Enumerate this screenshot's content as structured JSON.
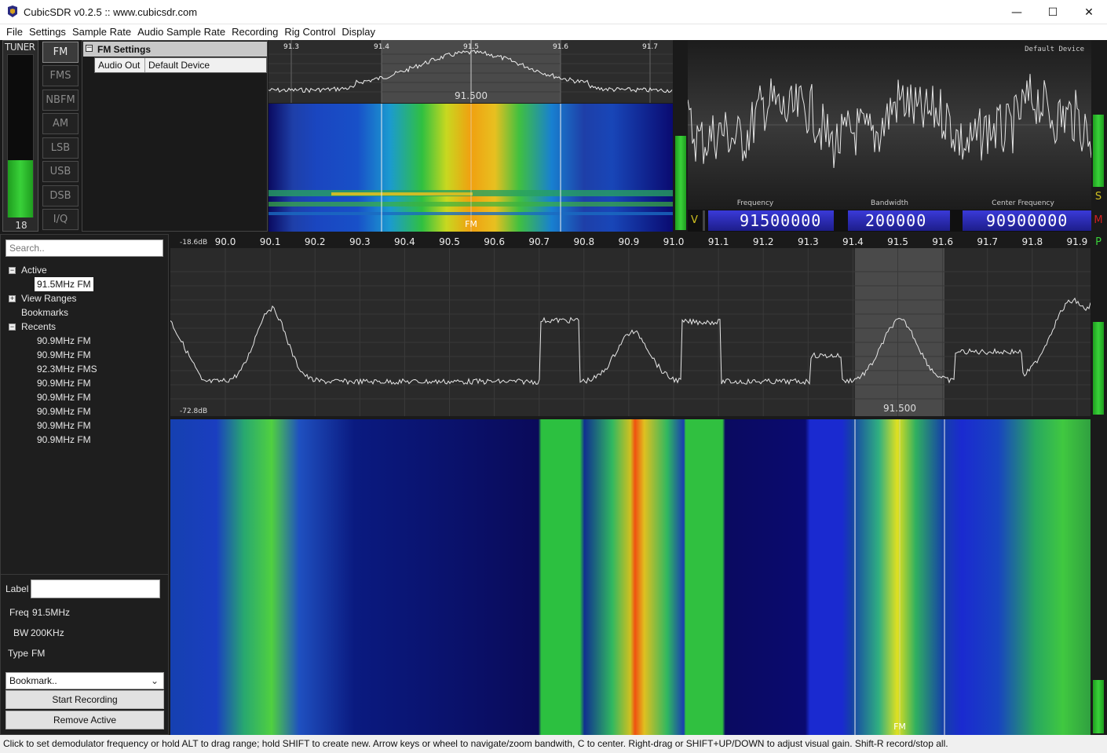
{
  "window": {
    "title": "CubicSDR v0.2.5 :: www.cubicsdr.com",
    "minimize": "—",
    "maximize": "☐",
    "close": "✕"
  },
  "menu": [
    "File",
    "Settings",
    "Sample Rate",
    "Audio Sample Rate",
    "Recording",
    "Rig Control",
    "Display"
  ],
  "tuner": {
    "label": "TUNER",
    "value": "18",
    "level": 0.35
  },
  "modes": [
    {
      "label": "FM",
      "selected": true
    },
    {
      "label": "FMS"
    },
    {
      "label": "NBFM"
    },
    {
      "label": "AM"
    },
    {
      "label": "LSB"
    },
    {
      "label": "USB"
    },
    {
      "label": "DSB"
    },
    {
      "label": "I/Q"
    }
  ],
  "fm_settings": {
    "title": "FM Settings",
    "toggle": "−",
    "audio_out_label": "Audio Out",
    "audio_out_value": "Default Device"
  },
  "mini_spectrum": {
    "ticks": [
      "91.3",
      "91.4",
      "91.5",
      "91.6",
      "91.7"
    ],
    "center_label": "91.500",
    "mode_label": "FM"
  },
  "scope": {
    "device": "Default Device",
    "frequency_label": "Frequency",
    "bandwidth_label": "Bandwidth",
    "center_label": "Center Frequency",
    "frequency": "91500000",
    "bandwidth": "200000",
    "center": "90900000",
    "v_label": "V"
  },
  "side_icons": {
    "s": "S",
    "m": "M",
    "p": "P"
  },
  "bookmarks": {
    "search_placeholder": "Search..",
    "active_label": "Active",
    "active_item": "91.5MHz FM",
    "view_ranges": "View Ranges",
    "bookmarks": "Bookmarks",
    "recents_label": "Recents",
    "recents": [
      "90.9MHz FM",
      "90.9MHz FM",
      "92.3MHz FMS",
      "90.9MHz FM",
      "90.9MHz FM",
      "90.9MHz FM",
      "90.9MHz FM",
      "90.9MHz FM"
    ],
    "label_label": "Label",
    "label_value": "",
    "freq_label": "Freq",
    "freq_value": "91.5MHz",
    "bw_label": "BW",
    "bw_value": "200KHz",
    "type_label": "Type",
    "type_value": "FM",
    "bookmark_select": "Bookmark..",
    "start_recording": "Start Recording",
    "remove_active": "Remove Active"
  },
  "main_spectrum": {
    "ticks": [
      "90.0",
      "90.1",
      "90.2",
      "90.3",
      "90.4",
      "90.5",
      "90.6",
      "90.7",
      "90.8",
      "90.9",
      "91.0",
      "91.1",
      "91.2",
      "91.3",
      "91.4",
      "91.5",
      "91.6",
      "91.7",
      "91.8",
      "91.9"
    ],
    "top_db": "-18.6dB",
    "bottom_db": "-72.8dB",
    "center_label": "91.500",
    "mode_label": "FM"
  },
  "status": "Click to set demodulator frequency or hold ALT to drag range; hold SHIFT to create new. Arrow keys or wheel to navigate/zoom bandwith, C to center. Right-drag or SHIFT+UP/DOWN to adjust visual gain. Shift-R record/stop all.",
  "colors": {
    "accent_green": "#39d139",
    "digit_blue": "#2b2bd0",
    "status_red": "#d02020",
    "status_yellow": "#d0c020"
  }
}
